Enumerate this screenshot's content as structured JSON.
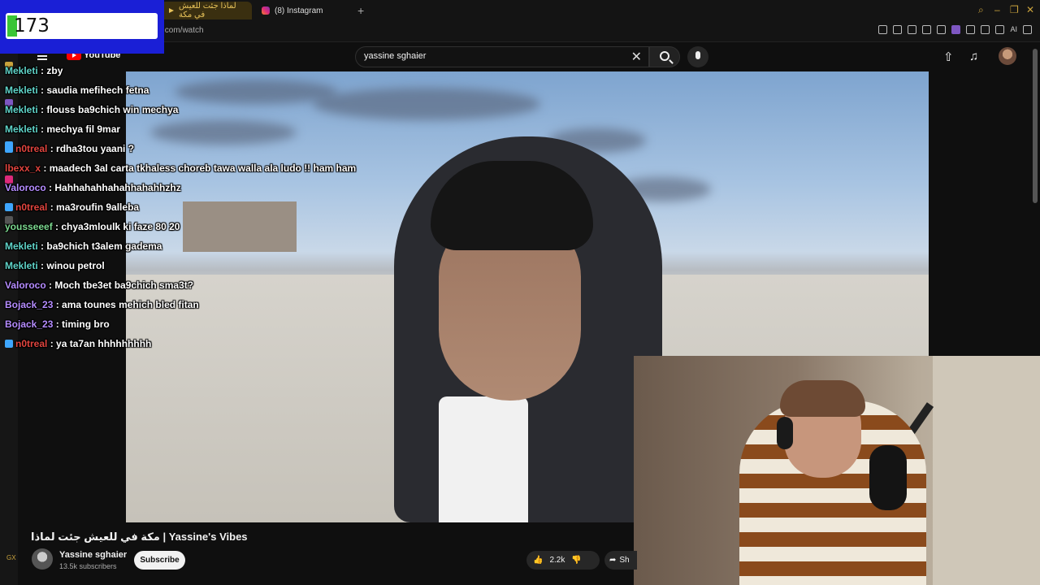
{
  "counter": {
    "value": "173"
  },
  "browser": {
    "tabs": [
      {
        "label": "لماذا جئت للعيش في مكة"
      },
      {
        "label": "(8) Instagram"
      }
    ],
    "new_tab": "+",
    "url": ".com/watch",
    "ai_label": "AI"
  },
  "youtube": {
    "logo_text": "YouTube",
    "search": {
      "value": "yassine sghaier",
      "clear": "✕"
    }
  },
  "chat": [
    {
      "user": "Mekleti",
      "color": "#5fd3c8",
      "message": "zby",
      "badge": false
    },
    {
      "user": "Mekleti",
      "color": "#5fd3c8",
      "message": "saudia mefihech fetna",
      "badge": false
    },
    {
      "user": "Mekleti",
      "color": "#5fd3c8",
      "message": "flouss ba9chich win mechya",
      "badge": false
    },
    {
      "user": "Mekleti",
      "color": "#5fd3c8",
      "message": "mechya fil 9mar",
      "badge": false
    },
    {
      "user": "n0treal",
      "color": "#e0443e",
      "message": "rdha3tou yaani ?",
      "badge": true
    },
    {
      "user": "lbexx_x",
      "color": "#e0443e",
      "message": "maadech 3al carta tkhaless choreb tawa walla ala ludo !! ham ham",
      "badge": false
    },
    {
      "user": "Valoroco",
      "color": "#b58cff",
      "message": "Hahhahahhahahhahahhzhz",
      "badge": false
    },
    {
      "user": "n0treal",
      "color": "#e0443e",
      "message": "ma3roufin 9alleba",
      "badge": true
    },
    {
      "user": "yousseeef",
      "color": "#7bd88f",
      "message": "chya3mloulk ki faze 80 20",
      "badge": false
    },
    {
      "user": "Mekleti",
      "color": "#5fd3c8",
      "message": "ba9chich t3alem gadema",
      "badge": false
    },
    {
      "user": "Mekleti",
      "color": "#5fd3c8",
      "message": "winou petrol",
      "badge": false
    },
    {
      "user": "Valoroco",
      "color": "#b58cff",
      "message": "Moch tbe3et ba9chich sma3t?",
      "badge": false
    },
    {
      "user": "Bojack_23",
      "color": "#b58cff",
      "message": "ama tounes mehich bled fitan",
      "badge": false
    },
    {
      "user": "Bojack_23",
      "color": "#b58cff",
      "message": "timing bro",
      "badge": false
    },
    {
      "user": "n0treal",
      "color": "#e0443e",
      "message": "ya ta7an hhhhhhhhh",
      "badge": true
    }
  ],
  "video": {
    "title": "مكة في للعيش جئت لماذا | Yassine's Vibes",
    "channel": "Yassine sghaier",
    "subscribers": "13.5k subscribers",
    "subscribe_label": "Subscribe",
    "likes": "2.2k",
    "share_label": "Sh"
  },
  "sidebar": {
    "gx_label": "GX"
  },
  "colors": {
    "accent": "#e8c35a",
    "counter_bg": "#1a1fd6",
    "counter_fill": "#39c535"
  }
}
